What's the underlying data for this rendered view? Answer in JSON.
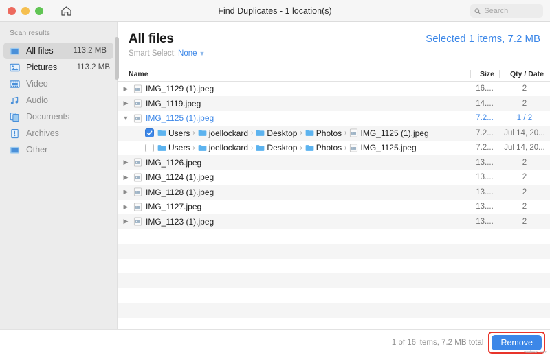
{
  "window": {
    "title": "Find Duplicates - 1 location(s)",
    "traffic_lights": [
      "close",
      "minimize",
      "maximize"
    ],
    "home_icon": "home-icon"
  },
  "search": {
    "value": "",
    "placeholder": "Search",
    "icon": "search-icon"
  },
  "sidebar": {
    "title": "Scan results",
    "items": [
      {
        "label": "All files",
        "size": "113.2 MB",
        "icon": "folder-icon",
        "state": "active"
      },
      {
        "label": "Pictures",
        "size": "113.2 MB",
        "icon": "picture-icon",
        "state": "enabled"
      },
      {
        "label": "Video",
        "size": "",
        "icon": "video-icon",
        "state": "disabled"
      },
      {
        "label": "Audio",
        "size": "",
        "icon": "audio-icon",
        "state": "disabled"
      },
      {
        "label": "Documents",
        "size": "",
        "icon": "document-icon",
        "state": "disabled"
      },
      {
        "label": "Archives",
        "size": "",
        "icon": "archive-icon",
        "state": "disabled"
      },
      {
        "label": "Other",
        "size": "",
        "icon": "other-icon",
        "state": "disabled"
      }
    ]
  },
  "main": {
    "page_title": "All files",
    "selected_info": "Selected 1 items, 7.2 MB",
    "smart_select_label": "Smart Select:",
    "smart_select_value": "None",
    "columns": {
      "name": "Name",
      "size": "Size",
      "qty": "Qty / Date"
    },
    "rows": [
      {
        "type": "parent",
        "expanded": false,
        "name": "IMG_1129 (1).jpeg",
        "size": "16....",
        "qty": "2"
      },
      {
        "type": "parent",
        "expanded": false,
        "name": "IMG_1119.jpeg",
        "size": "14....",
        "qty": "2"
      },
      {
        "type": "parent",
        "expanded": true,
        "name": "IMG_1125 (1).jpeg",
        "size": "7.2...",
        "qty": "1 / 2",
        "highlighted": true
      },
      {
        "type": "child",
        "checked": true,
        "path": [
          "Users",
          "joellockard",
          "Desktop",
          "Photos"
        ],
        "name": "IMG_1125 (1).jpeg",
        "size": "7.2...",
        "qty": "Jul 14, 20..."
      },
      {
        "type": "child",
        "checked": false,
        "path": [
          "Users",
          "joellockard",
          "Desktop",
          "Photos"
        ],
        "name": "IMG_1125.jpeg",
        "size": "7.2...",
        "qty": "Jul 14, 20..."
      },
      {
        "type": "parent",
        "expanded": false,
        "name": "IMG_1126.jpeg",
        "size": "13....",
        "qty": "2"
      },
      {
        "type": "parent",
        "expanded": false,
        "name": "IMG_1124 (1).jpeg",
        "size": "13....",
        "qty": "2"
      },
      {
        "type": "parent",
        "expanded": false,
        "name": "IMG_1128 (1).jpeg",
        "size": "13....",
        "qty": "2"
      },
      {
        "type": "parent",
        "expanded": false,
        "name": "IMG_1127.jpeg",
        "size": "13....",
        "qty": "2"
      },
      {
        "type": "parent",
        "expanded": false,
        "name": "IMG_1123 (1).jpeg",
        "size": "13....",
        "qty": "2"
      }
    ],
    "empty_row_count": 8
  },
  "footer": {
    "status": "1 of 16 items, 7.2 MB total",
    "remove_label": "Remove",
    "watermark": "wsdown.com"
  },
  "colors": {
    "accent": "#3c87e8",
    "highlight_box": "#e8342a",
    "sidebar_bg": "#ececec",
    "row_stripe": "#f5f5f5"
  }
}
